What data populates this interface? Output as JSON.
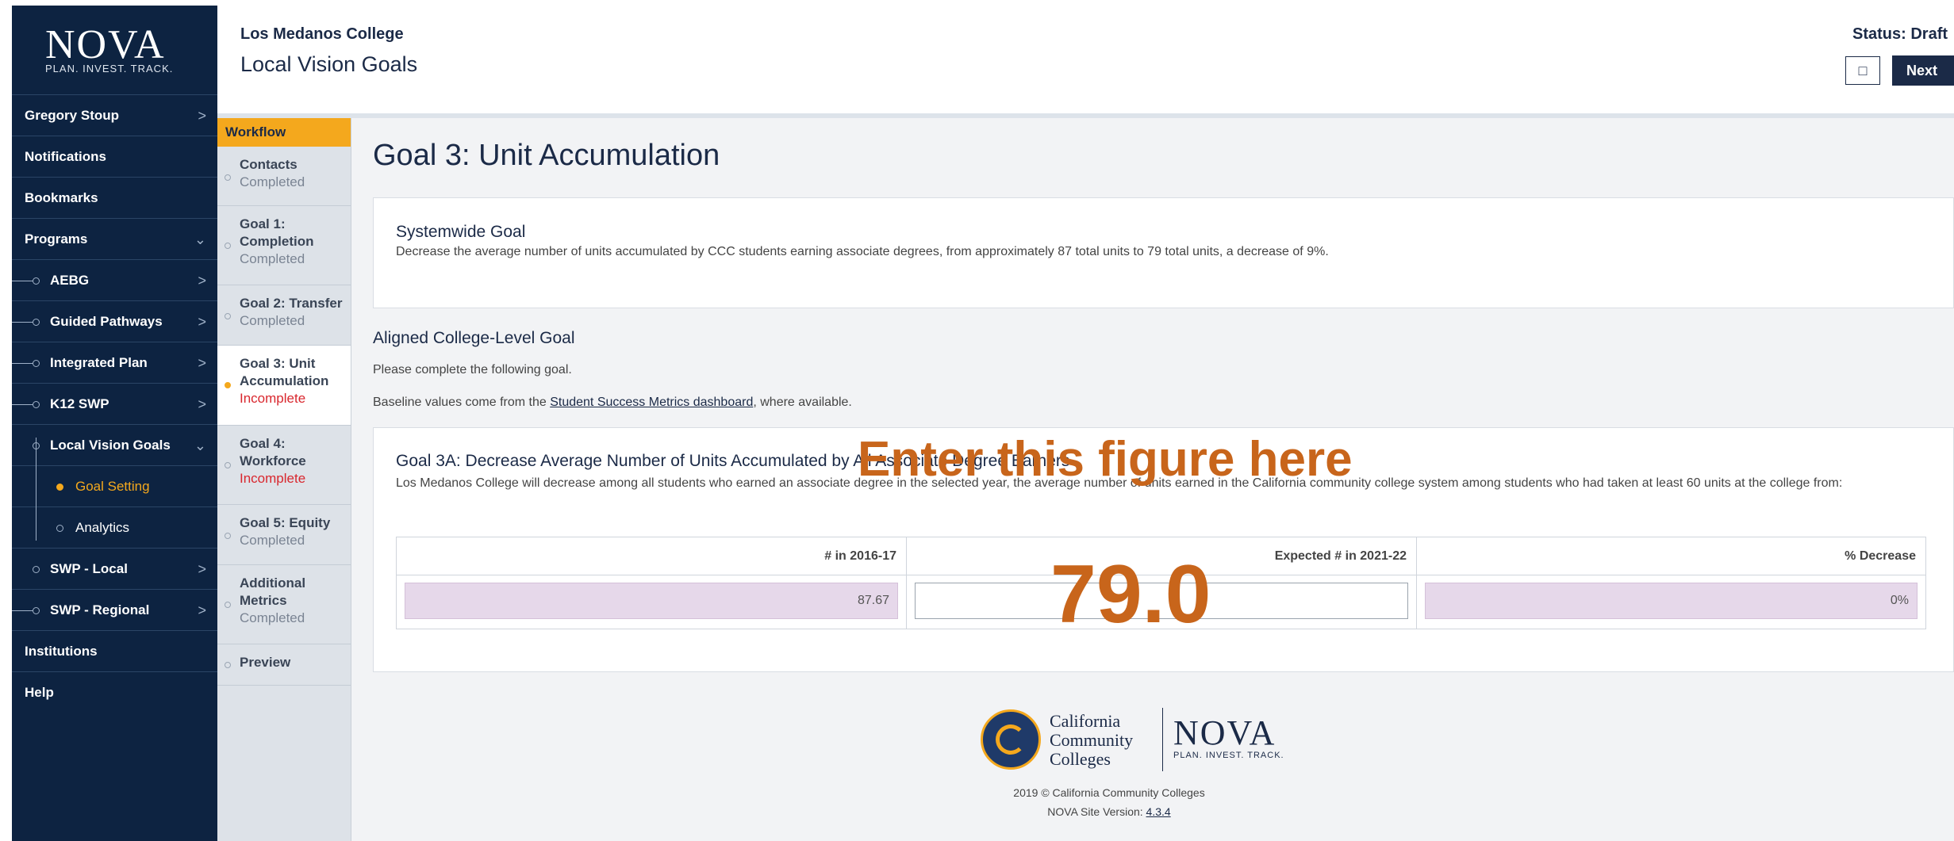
{
  "brand": {
    "logo_text": "NOVA",
    "tagline": "PLAN. INVEST. TRACK."
  },
  "sidebar": {
    "items": [
      {
        "label": "Gregory Stoup"
      },
      {
        "label": "Notifications"
      },
      {
        "label": "Bookmarks"
      },
      {
        "label": "Programs"
      },
      {
        "label": "AEBG"
      },
      {
        "label": "Guided Pathways"
      },
      {
        "label": "Integrated Plan"
      },
      {
        "label": "K12 SWP"
      },
      {
        "label": "Local Vision Goals"
      },
      {
        "label": "Goal Setting"
      },
      {
        "label": "Analytics"
      },
      {
        "label": "SWP - Local"
      },
      {
        "label": "SWP - Regional"
      },
      {
        "label": "Institutions"
      },
      {
        "label": "Help"
      }
    ]
  },
  "header": {
    "college": "Los Medanos College",
    "page_title": "Local Vision Goals",
    "status": "Status: Draft",
    "next_label": "Next"
  },
  "workflow": {
    "heading": "Workflow",
    "steps": [
      {
        "title": "Contacts",
        "status": "Completed"
      },
      {
        "title": "Goal 1: Completion",
        "status": "Completed"
      },
      {
        "title": "Goal 2: Transfer",
        "status": "Completed"
      },
      {
        "title": "Goal 3: Unit Accumulation",
        "status": "Incomplete"
      },
      {
        "title": "Goal 4: Workforce",
        "status": "Incomplete"
      },
      {
        "title": "Goal 5: Equity",
        "status": "Completed"
      },
      {
        "title": "Additional Metrics",
        "status": "Completed"
      },
      {
        "title": "Preview",
        "status": ""
      }
    ]
  },
  "main": {
    "goal_title": "Goal 3: Unit Accumulation",
    "systemwide": {
      "heading": "Systemwide Goal",
      "text": "Decrease the average number of units accumulated by CCC students earning associate degrees, from approximately 87 total units to 79 total units, a decrease of 9%."
    },
    "aligned_heading": "Aligned College-Level Goal",
    "aligned_note": "Please complete the following goal.",
    "baseline_prefix": "Baseline values come from the ",
    "baseline_link": "Student Success Metrics dashboard",
    "baseline_suffix": ", where available.",
    "goal3a": {
      "heading": "Goal 3A: Decrease Average Number of Units Accumulated by All Associate Degree Earners",
      "text": "Los Medanos College will decrease among all students who earned an associate degree in the selected year, the average number of units earned in the California community college system among students who had taken at least 60 units at the college from:"
    },
    "table": {
      "headers": [
        "# in 2016-17",
        "Expected # in 2021-22",
        "% Decrease"
      ],
      "baseline_value": "87.67",
      "expected_value": "",
      "decrease_value": "0%"
    }
  },
  "overlay": {
    "instruction": "Enter this figure here",
    "value": "79.0"
  },
  "footer": {
    "ccc_line1": "California",
    "ccc_line2": "Community",
    "ccc_line3": "Colleges",
    "nova_text": "NOVA",
    "nova_tagline": "PLAN. INVEST. TRACK.",
    "copyright": "2019 © California Community Colleges",
    "version_prefix": "NOVA Site Version: ",
    "version": "4.3.4"
  },
  "colors": {
    "nav_bg": "#0d2341",
    "accent": "#f4a81d",
    "overlay": "#c8651b",
    "incomplete": "#d9272e",
    "readonly_cell": "#e6d8ea"
  }
}
